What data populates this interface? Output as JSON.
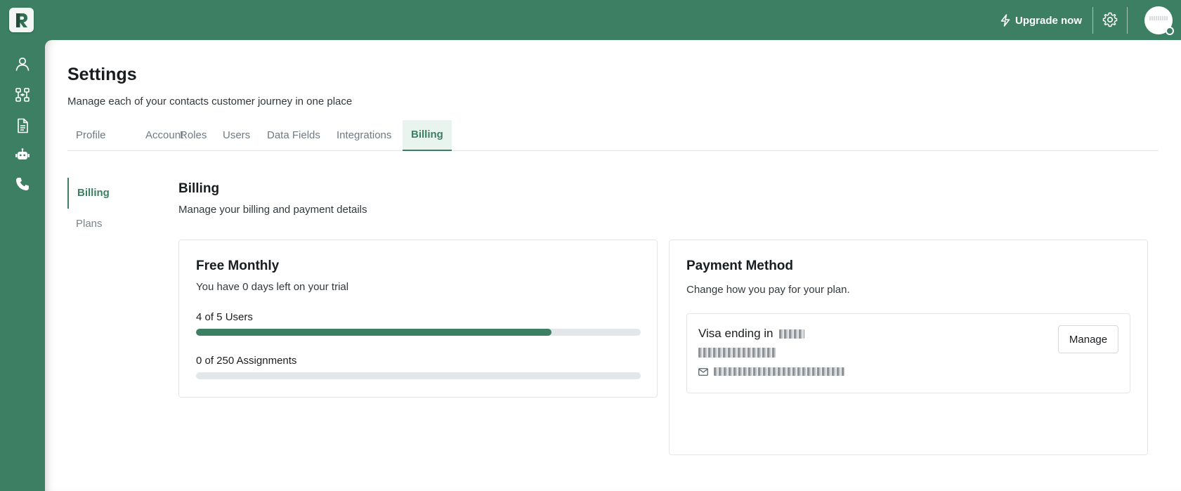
{
  "topbar": {
    "logo_letter": "R",
    "upgrade_label": "Upgrade now",
    "icons": [
      "bolt-icon",
      "gear-icon",
      "avatar"
    ]
  },
  "rail": {
    "icons": [
      "user-icon",
      "org-chart-icon",
      "document-icon",
      "robot-icon",
      "phone-icon"
    ]
  },
  "page": {
    "title": "Settings",
    "subtitle": "Manage each of your contacts customer journey in one place"
  },
  "tabs": [
    {
      "label": "Profile",
      "active": false
    },
    {
      "label": "Account",
      "active": false
    },
    {
      "label": "Roles",
      "active": false
    },
    {
      "label": "Users",
      "active": false
    },
    {
      "label": "Data Fields",
      "active": false
    },
    {
      "label": "Integrations",
      "active": false
    },
    {
      "label": "Billing",
      "active": true
    }
  ],
  "subnav": [
    {
      "label": "Billing",
      "active": true
    },
    {
      "label": "Plans",
      "active": false
    }
  ],
  "billing": {
    "title": "Billing",
    "subtitle": "Manage your billing and payment details"
  },
  "plan": {
    "title": "Free Monthly",
    "subtitle": "You have 0 days left on your trial",
    "usages": [
      {
        "label": "4 of 5 Users",
        "fraction": 0.8
      },
      {
        "label": "0 of 250 Assignments",
        "fraction": 0.0
      }
    ]
  },
  "payment": {
    "title": "Payment Method",
    "subtitle": "Change how you pay for your plan.",
    "card_label": "Visa ending in",
    "manage_label": "Manage"
  },
  "colors": {
    "brand": "#3d7f62",
    "active_tab_bg": "#e9f4ee",
    "track": "#e4e7ea"
  }
}
